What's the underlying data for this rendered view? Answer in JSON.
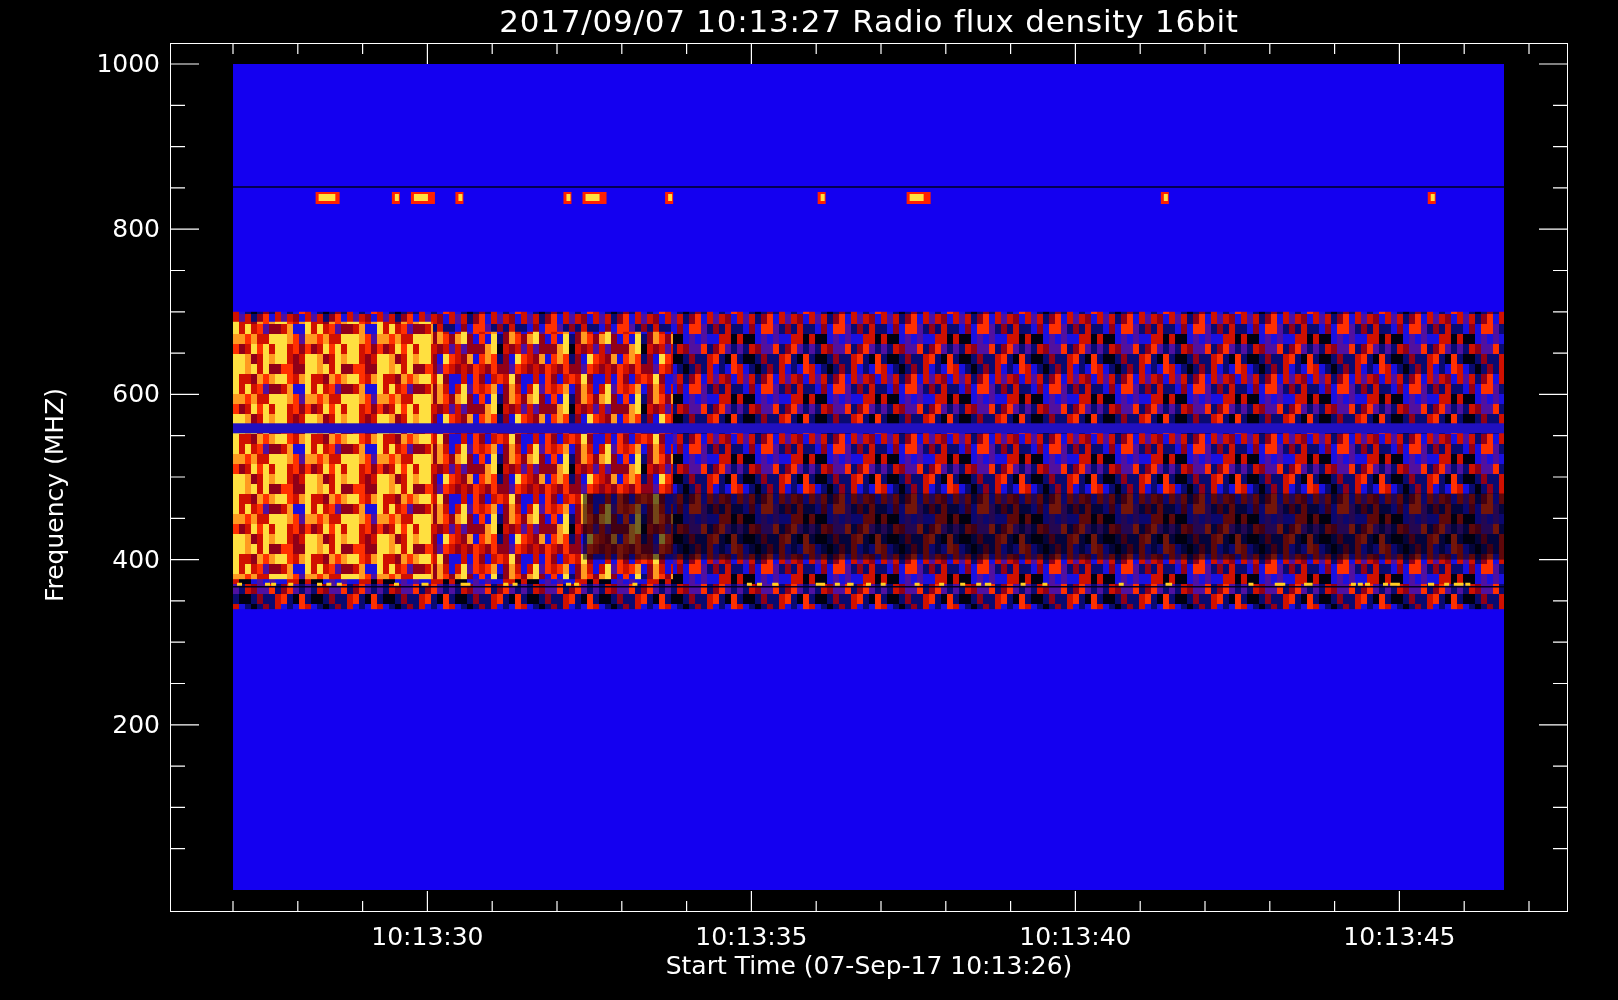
{
  "title": "2017/09/07 10:13:27 Radio flux density 16bit",
  "y_axis": {
    "label": "Frequency (MHZ)",
    "tick_labels": [
      "1000",
      "800",
      "600",
      "400",
      "200"
    ]
  },
  "x_axis": {
    "label": "Start Time (07-Sep-17 10:13:26)",
    "tick_labels": [
      "10:13:30",
      "10:13:35",
      "10:13:40",
      "10:13:45"
    ]
  }
}
